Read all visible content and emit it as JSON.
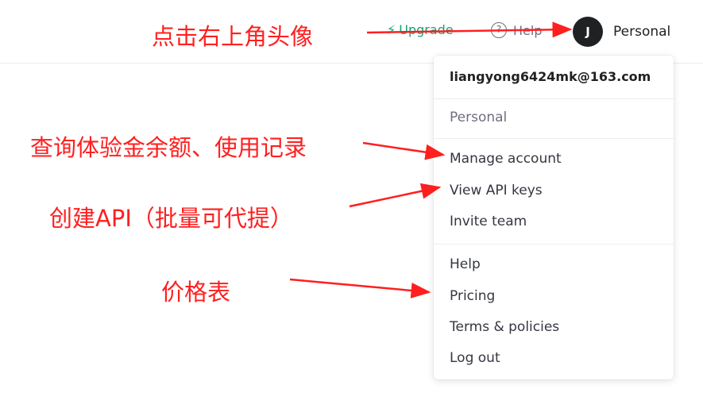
{
  "header": {
    "upgrade_label": "Upgrade",
    "upgrade_icon": "lightning-icon",
    "help_label": "Help",
    "help_icon": "question-circle-icon",
    "avatar_initial": "J",
    "account_label": "Personal"
  },
  "menu": {
    "email": "liangyong6424mk@163.com",
    "org_label": "Personal",
    "items": [
      {
        "label": "Manage account"
      },
      {
        "label": "View API keys"
      },
      {
        "label": "Invite team"
      },
      {
        "label": "Help"
      },
      {
        "label": "Pricing"
      },
      {
        "label": "Terms & policies"
      },
      {
        "label": "Log out"
      }
    ]
  },
  "annotations": {
    "top": "点击右上角头像",
    "manage": "查询体验金余额、使用记录",
    "api": "创建API（批量可代提）",
    "pricing": "价格表"
  },
  "colors": {
    "accent": "#10a37f",
    "annotation": "#ff1f1f",
    "avatar_bg": "#202123"
  }
}
